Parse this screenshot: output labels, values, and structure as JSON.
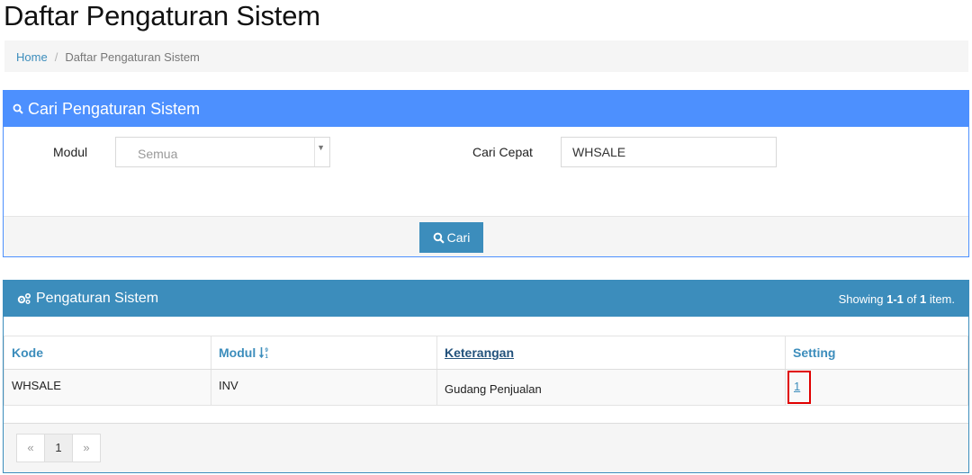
{
  "page": {
    "title": "Daftar Pengaturan Sistem"
  },
  "breadcrumb": {
    "home": "Home",
    "separator": "/",
    "current": "Daftar Pengaturan Sistem"
  },
  "search_panel": {
    "title": "Cari Pengaturan Sistem",
    "modul_label": "Modul",
    "modul_value": "Semua",
    "cari_cepat_label": "Cari Cepat",
    "cari_cepat_value": "WHSALE",
    "button_label": "Cari"
  },
  "grid": {
    "title": "Pengaturan Sistem",
    "summary_prefix": "Showing ",
    "summary_range": "1-1",
    "summary_of": " of ",
    "summary_total": "1",
    "summary_suffix": " item.",
    "columns": [
      "Kode",
      "Modul",
      "Keterangan",
      "Setting"
    ],
    "rows": [
      {
        "kode": "WHSALE",
        "modul": "INV",
        "keterangan": "Gudang Penjualan",
        "setting": "1"
      }
    ],
    "pagination": {
      "prev": "«",
      "page": "1",
      "next": "»"
    }
  },
  "colors": {
    "search_header": "#4d90fe",
    "grid_header": "#3c8dbc",
    "highlight": "#e00000"
  }
}
